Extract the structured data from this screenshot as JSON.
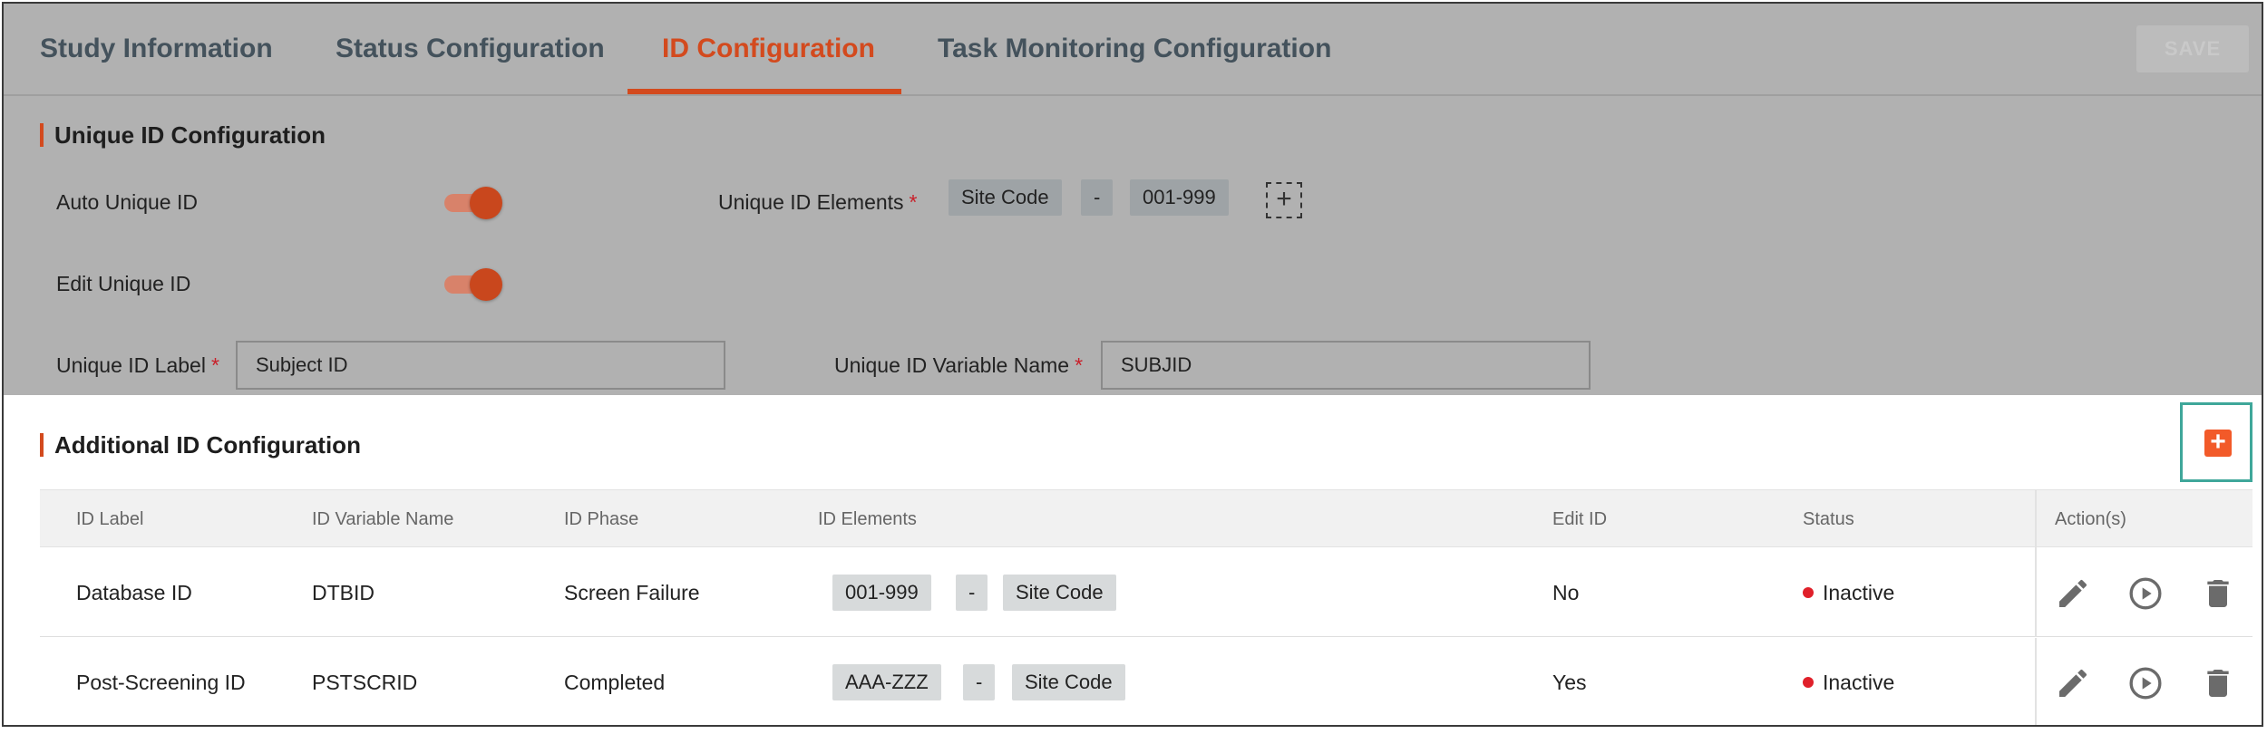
{
  "tabs": [
    {
      "label": "Study Information",
      "active": false
    },
    {
      "label": "Status Configuration",
      "active": false
    },
    {
      "label": "ID Configuration",
      "active": true
    },
    {
      "label": "Task Monitoring Configuration",
      "active": false
    }
  ],
  "save_label": "SAVE",
  "unique": {
    "title": "Unique ID Configuration",
    "auto_label": "Auto Unique ID",
    "auto_on": true,
    "edit_label": "Edit Unique ID",
    "edit_on": true,
    "elements_label": "Unique ID Elements",
    "elements": [
      "Site Code",
      "-",
      "001-999"
    ],
    "id_label_label": "Unique ID Label",
    "id_label_value": "Subject ID",
    "var_label": "Unique ID Variable Name",
    "var_value": "SUBJID",
    "required_mark": "*"
  },
  "additional": {
    "title": "Additional ID Configuration",
    "add_symbol": "+",
    "columns": [
      "ID Label",
      "ID Variable Name",
      "ID Phase",
      "ID Elements",
      "Edit ID",
      "Status",
      "Action(s)"
    ],
    "rows": [
      {
        "label": "Database ID",
        "variable": "DTBID",
        "phase": "Screen Failure",
        "elements": [
          "001-999",
          "-",
          "Site Code"
        ],
        "edit": "No",
        "status": "Inactive"
      },
      {
        "label": "Post-Screening ID",
        "variable": "PSTSCRID",
        "phase": "Completed",
        "elements": [
          "AAA-ZZZ",
          "-",
          "Site Code"
        ],
        "edit": "Yes",
        "status": "Inactive"
      }
    ]
  },
  "colors": {
    "accent": "#d34a1e",
    "inactive_status": "#e0202a",
    "add_button": "#f25a29",
    "highlight": "#3fa79a"
  },
  "icons": {
    "edit": "pencil-icon",
    "run": "play-circle-icon",
    "delete": "trash-icon",
    "add": "plus-icon"
  }
}
